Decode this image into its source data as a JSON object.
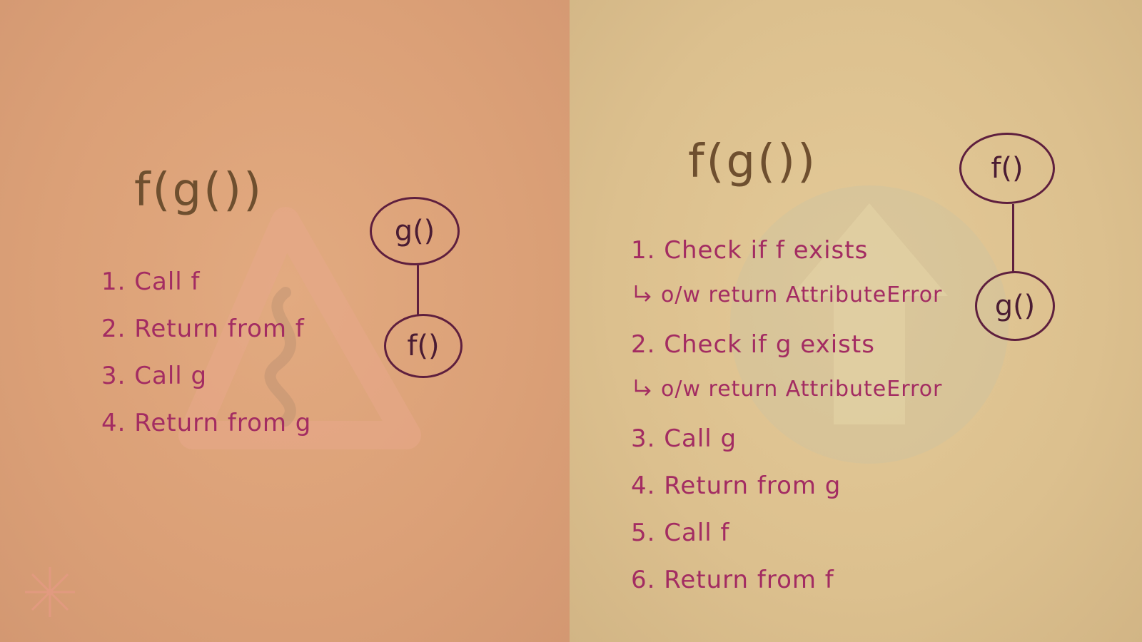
{
  "left": {
    "expression": "f(g())",
    "steps": [
      "1. Call f",
      "2. Return from f",
      "3. Call g",
      "4. Return from g"
    ],
    "tree": {
      "top": "g()",
      "bottom": "f()"
    }
  },
  "right": {
    "expression": "f(g())",
    "steps": [
      "1. Check if f exists",
      "o/w return AttributeError",
      "2. Check if g exists",
      "o/w return AttributeError",
      "3. Call g",
      "4. Return from g",
      "5. Call f",
      "6. Return from f"
    ],
    "tree": {
      "top": "f()",
      "bottom": "g()"
    }
  },
  "colors": {
    "left_bg": "#dba077",
    "right_bg": "#dcc08e",
    "ink_title": "#6e4f2f",
    "ink_steps": "#a32c62",
    "ink_tree": "#5e1f3e"
  }
}
